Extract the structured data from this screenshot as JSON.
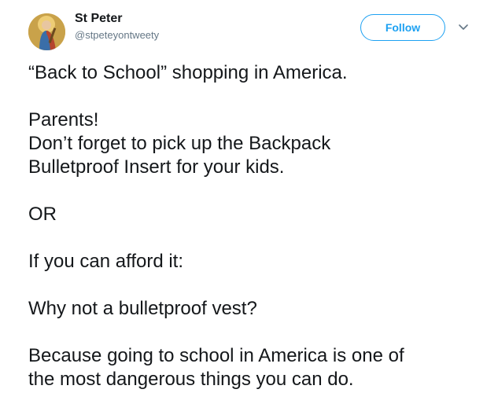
{
  "author": {
    "name": "St Peter",
    "handle": "@stpeteyontweety",
    "avatar": "saint-peter-avatar-icon"
  },
  "actions": {
    "follow_label": "Follow",
    "more_icon": "chevron-down-icon"
  },
  "colors": {
    "accent": "#1da1f2",
    "text": "#14171a",
    "secondary_text": "#657786"
  },
  "tweet": {
    "line_1": "“Back to School” shopping in America.",
    "line_2": "Parents!",
    "line_3": "Don’t forget to pick up the Backpack",
    "line_4": "Bulletproof Insert for your kids.",
    "line_5": "OR",
    "line_6": "If you can afford it:",
    "line_7": "Why not a bulletproof vest?",
    "line_8": "Because going to school in America is one of",
    "line_9": "the most dangerous things you can do."
  }
}
